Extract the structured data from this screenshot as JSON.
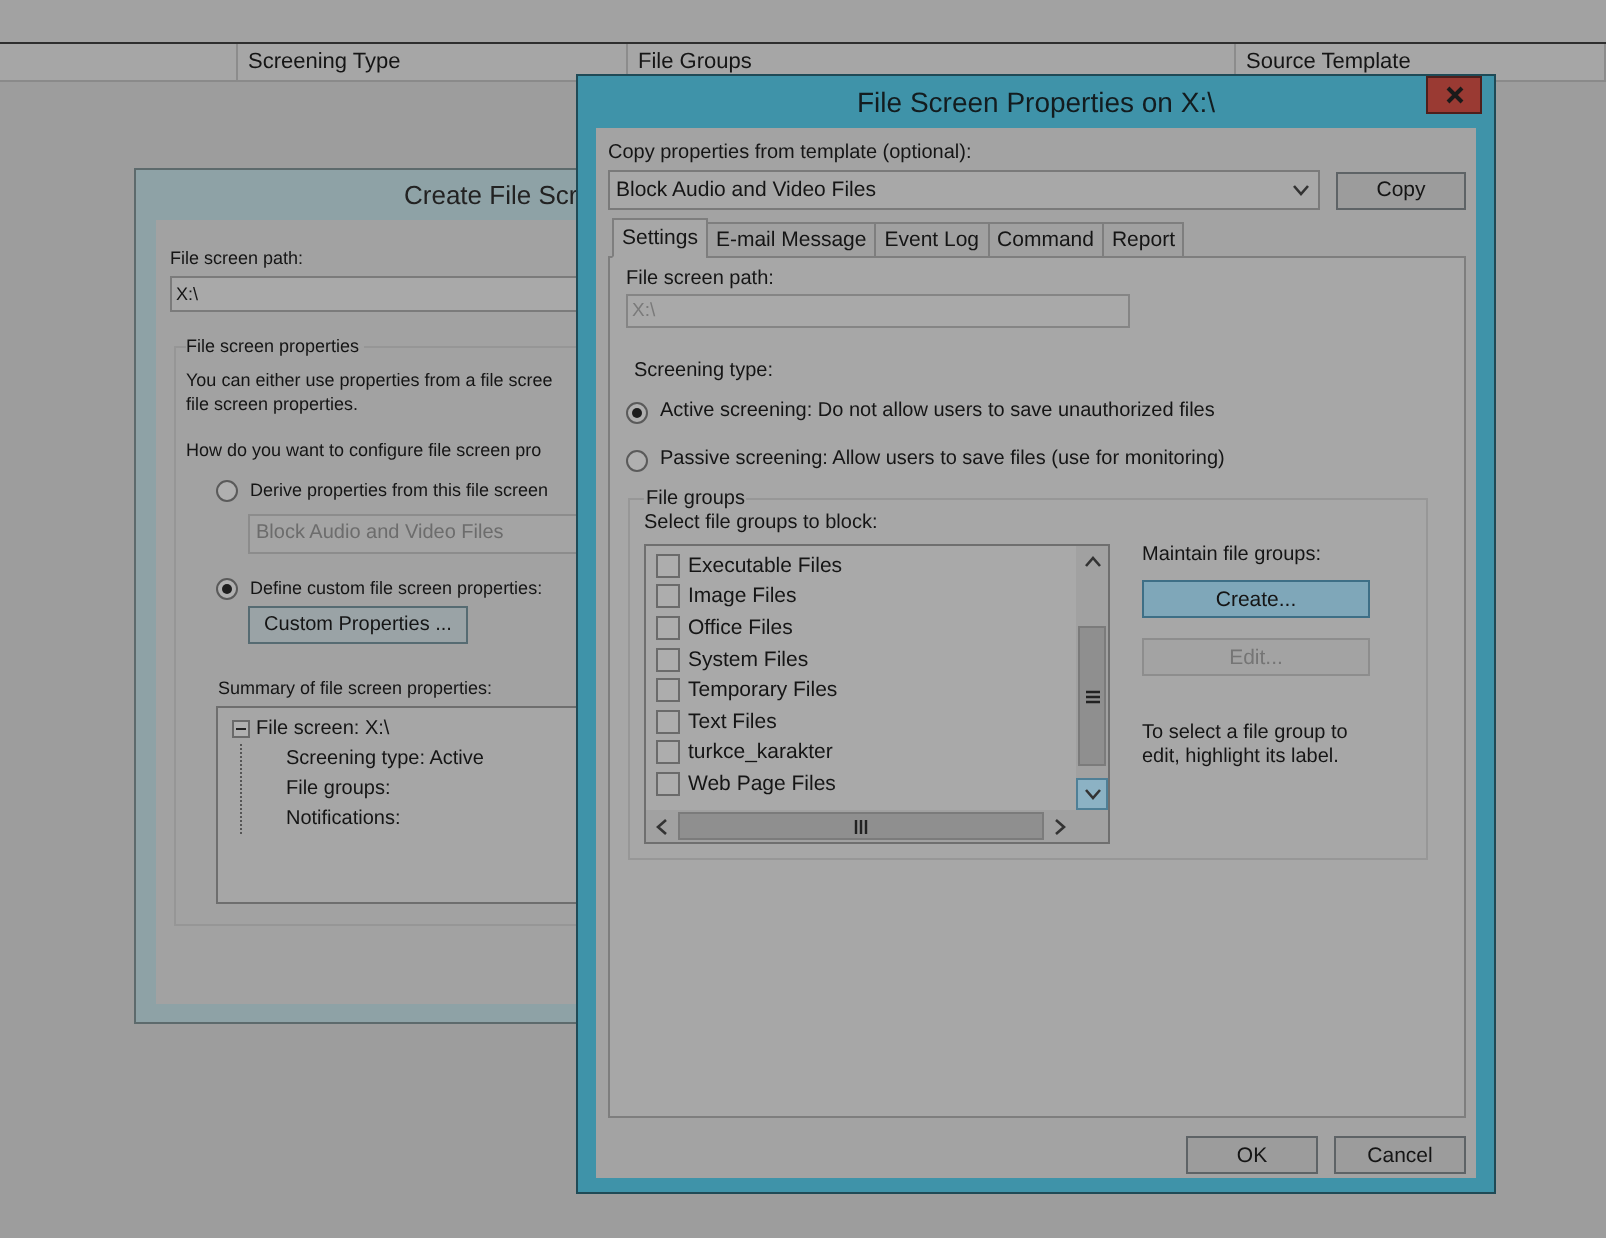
{
  "background_list": {
    "columns": [
      "Screening Type",
      "File Groups",
      "Source Template"
    ]
  },
  "back_dialog": {
    "title": "Create File Scr",
    "path_label": "File screen path:",
    "path_value": "X:\\",
    "group_title": "File screen properties",
    "intro": "You can either use properties from a file scree\nfile screen properties.",
    "question": "How do you want to configure file screen pro",
    "options": [
      {
        "label": "Derive properties from this file screen",
        "selected": false
      },
      {
        "label": "Define custom file screen properties:",
        "selected": true
      }
    ],
    "template_dropdown": {
      "value": "Block Audio and Video Files",
      "disabled": true
    },
    "custom_button": "Custom Properties ...",
    "summary_label": "Summary of file screen properties:",
    "summary_tree": [
      {
        "label": "File screen: X:\\",
        "expanded": true,
        "children": [
          {
            "label": "Screening type: Active"
          },
          {
            "label": "File groups:"
          },
          {
            "label": "Notifications:"
          }
        ]
      }
    ]
  },
  "dialog": {
    "title": "File Screen Properties on X:\\",
    "template_label": "Copy properties from template (optional):",
    "template_value": "Block Audio and Video Files",
    "copy_button": "Copy",
    "tabs": [
      {
        "label": "Settings",
        "selected": true
      },
      {
        "label": "E-mail Message",
        "selected": false
      },
      {
        "label": "Event Log",
        "selected": false
      },
      {
        "label": "Command",
        "selected": false
      },
      {
        "label": "Report",
        "selected": false
      }
    ],
    "path_label": "File screen path:",
    "path_field": {
      "value": "X:\\",
      "disabled": true
    },
    "screening_label": "Screening type:",
    "screening_options": [
      {
        "label": "Active screening: Do not allow users to save unauthorized files",
        "selected": true
      },
      {
        "label": "Passive screening: Allow users to save files (use for monitoring)",
        "selected": false
      }
    ],
    "file_groups": {
      "title": "File groups",
      "list_label": "Select file groups to block:",
      "items": [
        {
          "label": "Executable Files",
          "checked": false
        },
        {
          "label": "Image Files",
          "checked": false
        },
        {
          "label": "Office Files",
          "checked": false
        },
        {
          "label": "System Files",
          "checked": false
        },
        {
          "label": "Temporary Files",
          "checked": false
        },
        {
          "label": "Text Files",
          "checked": false
        },
        {
          "label": "turkce_karakter",
          "checked": false
        },
        {
          "label": "Web Page Files",
          "checked": false
        }
      ],
      "maintain_label": "Maintain file groups:",
      "buttons": [
        {
          "label": "Create...",
          "focused": true,
          "disabled": false
        },
        {
          "label": "Edit...",
          "focused": false,
          "disabled": true
        }
      ],
      "note": "To select a file group to edit, highlight its label."
    },
    "buttons": [
      "OK",
      "Cancel"
    ]
  }
}
